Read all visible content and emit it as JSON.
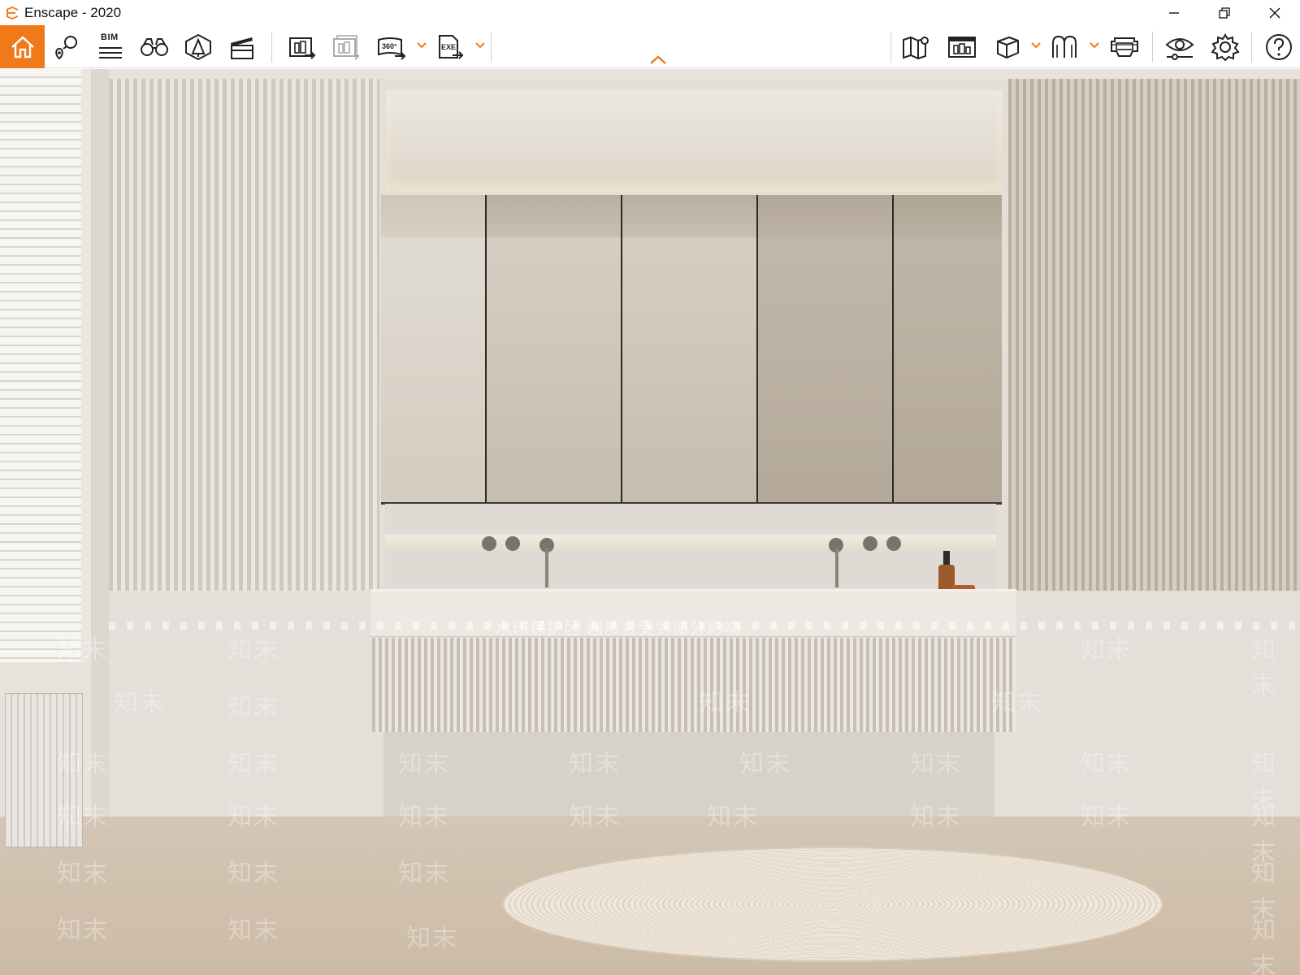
{
  "window": {
    "title": "Enscape - 2020",
    "logo_icon": "enscape-logo-icon",
    "controls": [
      "minimize-icon",
      "restore-icon",
      "close-icon"
    ]
  },
  "toolbar": {
    "accent_color": "#f07a1a",
    "bim_label": "BIM",
    "panorama_label": "360°",
    "exe_label": "EXE",
    "left_tools": [
      "home-icon",
      "views-icon",
      "bim-icon",
      "binoculars-icon",
      "asset-library-icon",
      "video-editor-icon",
      "screenshot-icon",
      "batch-render-icon",
      "panorama-icon",
      "export-exe-icon"
    ],
    "right_tools": [
      "map-icon",
      "minimap-icon",
      "cube-view-icon",
      "materials-icon",
      "vr-headset-icon",
      "visual-settings-icon",
      "settings-icon",
      "help-icon"
    ]
  },
  "viewport": {
    "watermark_text": "知末",
    "watermark_banner": "水印保护区    画质会受到部分影响"
  }
}
